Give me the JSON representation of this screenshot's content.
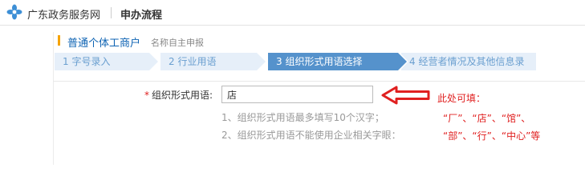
{
  "header": {
    "site_title": "广东政务服务网",
    "section_title": "申办流程"
  },
  "business_type": {
    "title": "普通个体工商户",
    "subtitle": "名称自主申报"
  },
  "steps": [
    {
      "label": "1 字号录入",
      "state": "done"
    },
    {
      "label": "2 行业用语",
      "state": "done"
    },
    {
      "label": "3 组织形式用语选择",
      "state": "active"
    },
    {
      "label": "4 经营者情况及其他信息录",
      "state": "todo"
    }
  ],
  "form": {
    "required_mark": "*",
    "org_form_label": "组织形式用语:",
    "org_form_value": "店"
  },
  "hints": [
    "1、组织形式用语最多填写10个汉字；",
    "2、组织形式用语不能使用企业相关字眼："
  ],
  "annotation": {
    "heading": "此处可填：",
    "line1": "“厂”、“店”、“馆”、",
    "line2": "“部”、“行”、“中心”等",
    "color": "#e02020"
  },
  "colors": {
    "brand_blue": "#0e63b3",
    "step_active": "#5592cc",
    "step_inactive": "#e6eff9",
    "accent_orange": "#f5a300"
  },
  "icons": {
    "logo": "flower-logo-icon",
    "pointer": "left-arrow-icon"
  }
}
